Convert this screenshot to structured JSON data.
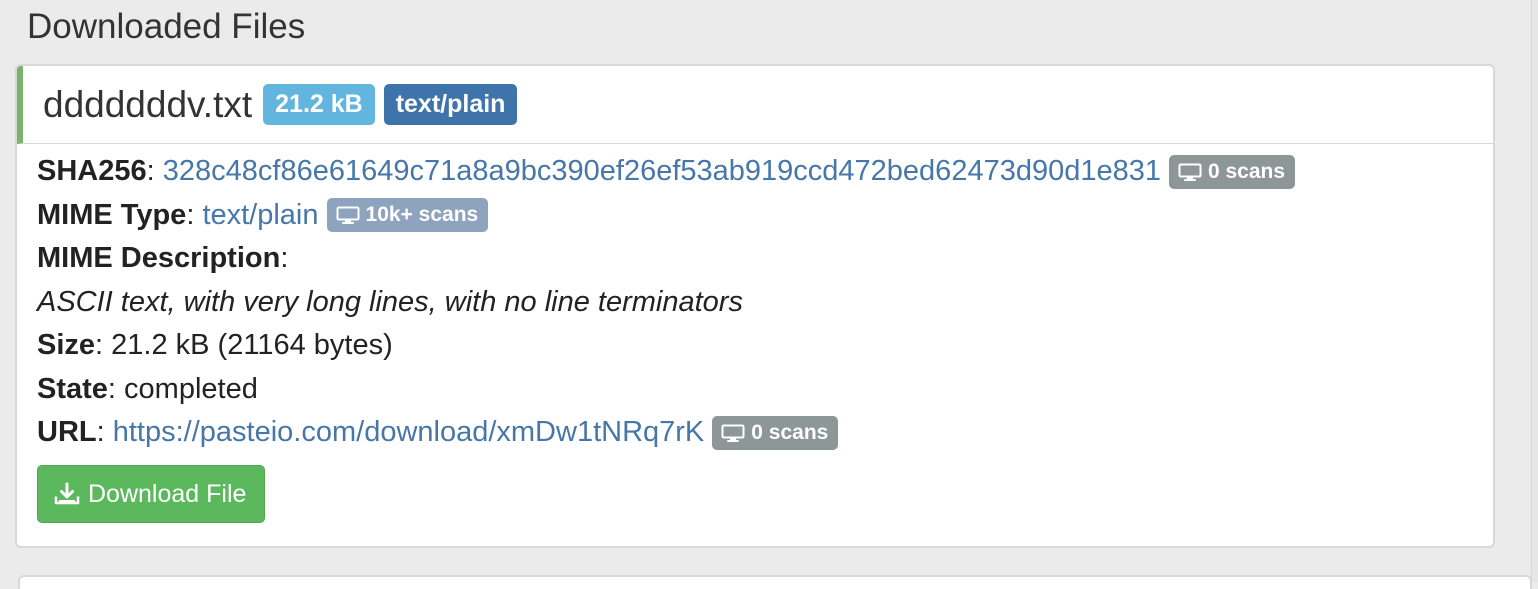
{
  "page": {
    "section_title": "Downloaded Files"
  },
  "file": {
    "name": "dddddddv.txt",
    "size_badge": "21.2 kB",
    "mime_badge": "text/plain",
    "sha256_label": "SHA256",
    "sha256_value": "328c48cf86e61649c71a8a9bc390ef26ef53ab919ccd472bed62473d90d1e831",
    "sha256_scans": "0 scans",
    "mime_type_label": "MIME Type",
    "mime_type_value": "text/plain",
    "mime_type_scans": "10k+ scans",
    "mime_description_label": "MIME Description",
    "mime_description_value": "ASCII text, with very long lines, with no line terminators",
    "size_label": "Size",
    "size_value": "21.2 kB (21164 bytes)",
    "state_label": "State",
    "state_value": "completed",
    "url_label": "URL",
    "url_value": "https://pasteio.com/download/xmDw1tNRq7rK",
    "url_scans": "0 scans",
    "download_label": "Download File"
  },
  "icons": {
    "scan_badge_icon": "monitor-icon",
    "download_icon": "download-icon"
  },
  "colors": {
    "accent_green": "#5cb85c",
    "status_border_green": "#7ab468",
    "size_badge": "#62b5df",
    "mime_badge": "#3f74aa",
    "link_blue": "#4677a8"
  }
}
